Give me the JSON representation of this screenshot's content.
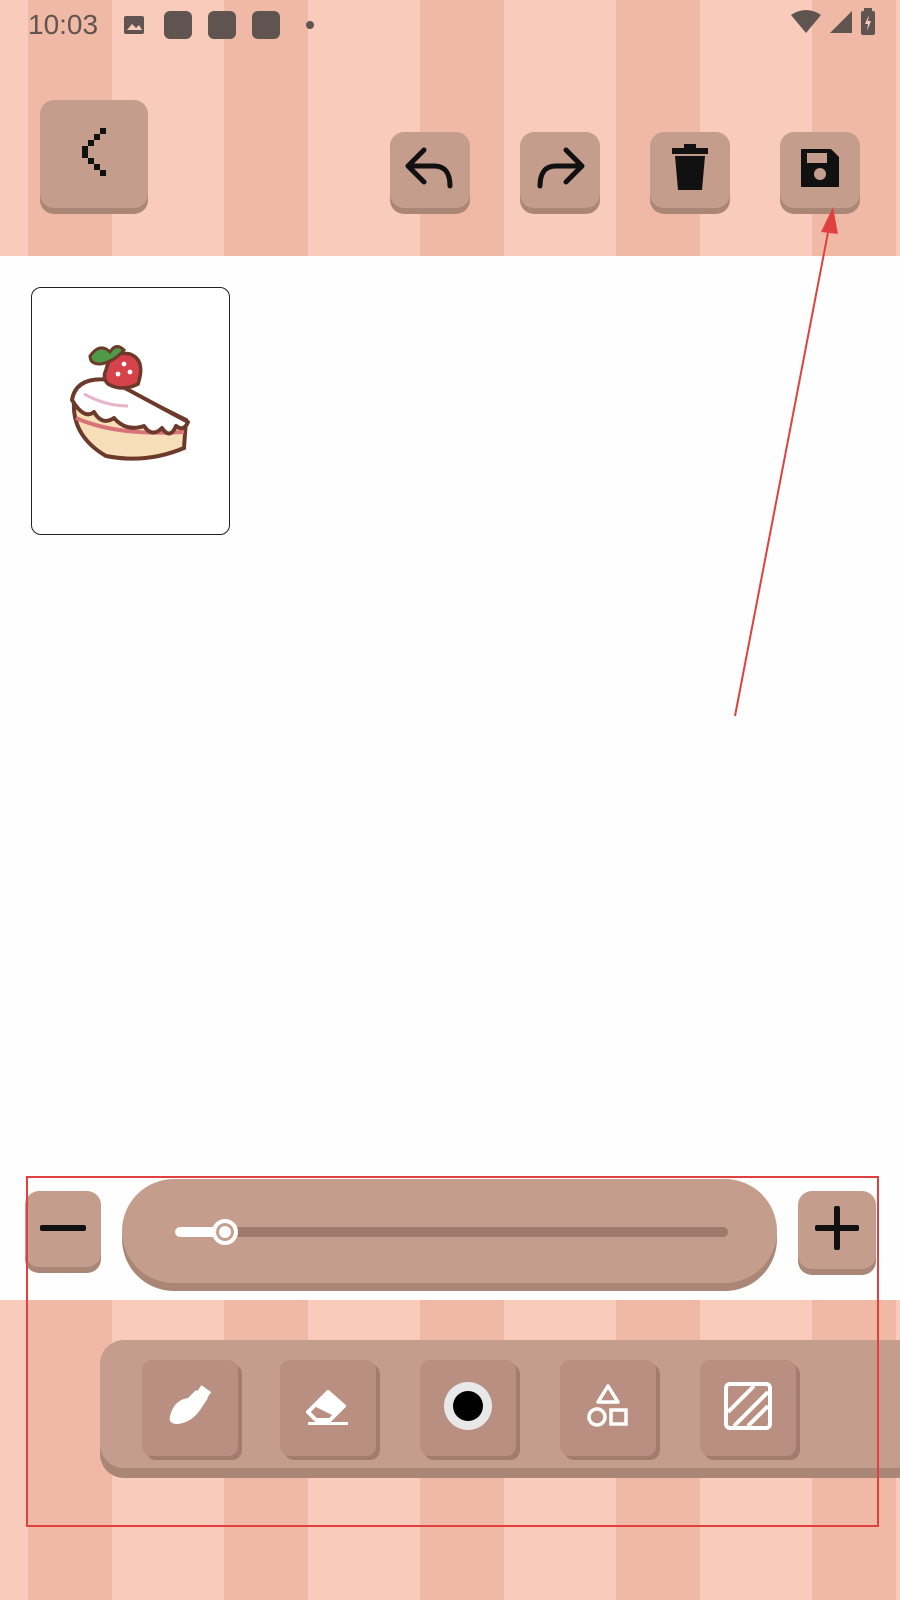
{
  "status_bar": {
    "time": "10:03",
    "left_icons": [
      "image-icon",
      "app-icon",
      "app-icon",
      "app-icon",
      "dot-icon"
    ],
    "right_icons": [
      "wifi-icon",
      "signal-icon",
      "battery-icon"
    ]
  },
  "toolbar": {
    "back": "back-icon",
    "undo": "undo-icon",
    "redo": "redo-icon",
    "delete": "trash-icon",
    "save": "save-icon"
  },
  "canvas": {
    "sticker": "cake-sticker"
  },
  "brush_size": {
    "value_fraction": 0.09,
    "minus_icon": "minus-icon",
    "plus_icon": "plus-icon"
  },
  "tools": [
    {
      "name": "brush",
      "icon": "brush-icon"
    },
    {
      "name": "eraser",
      "icon": "eraser-icon"
    },
    {
      "name": "color",
      "icon": "color-dot-icon"
    },
    {
      "name": "shapes",
      "icon": "shapes-icon"
    },
    {
      "name": "pattern",
      "icon": "pattern-icon"
    }
  ],
  "colors": {
    "stripe_light": "#f8cbbb",
    "stripe_dark": "#efb9a6",
    "button": "#c49d8d",
    "button_shadow": "#a98676",
    "annotation": "#e04040"
  }
}
